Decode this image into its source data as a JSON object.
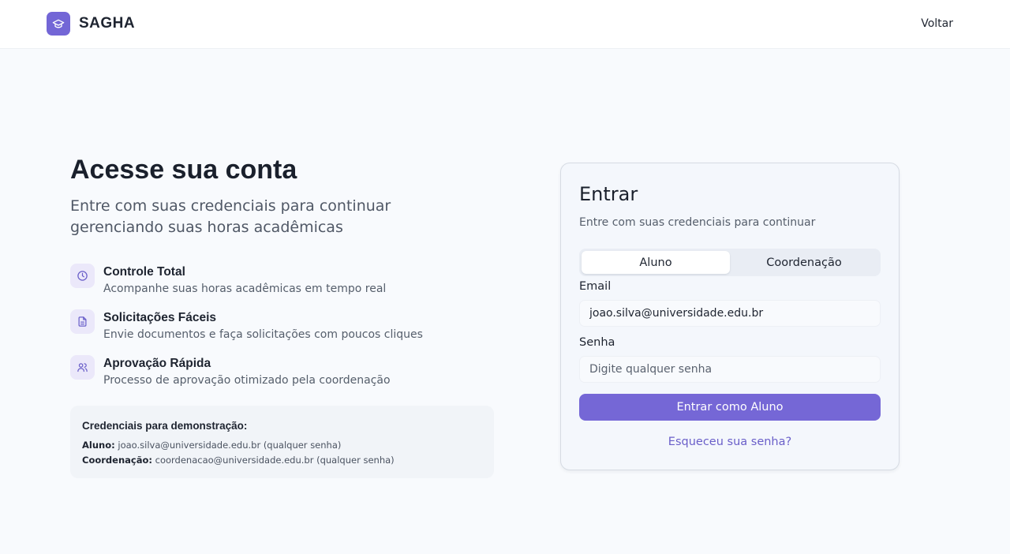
{
  "header": {
    "brand": "SAGHA",
    "back_label": "Voltar",
    "logo_icon": "graduation-cap-icon",
    "accent_color": "#7366d6"
  },
  "hero": {
    "title": "Acesse sua conta",
    "subtitle": "Entre com suas credenciais para continuar gerenciando suas horas acadêmicas"
  },
  "features": [
    {
      "icon": "clock-icon",
      "title": "Controle Total",
      "description": "Acompanhe suas horas acadêmicas em tempo real"
    },
    {
      "icon": "document-icon",
      "title": "Solicitações Fáceis",
      "description": "Envie documentos e faça solicitações com poucos cliques"
    },
    {
      "icon": "users-icon",
      "title": "Aprovação Rápida",
      "description": "Processo de aprovação otimizado pela coordenação"
    }
  ],
  "demo": {
    "title": "Credenciais para demonstração:",
    "student_label": "Aluno:",
    "student_value": "joao.silva@universidade.edu.br (qualquer senha)",
    "coord_label": "Coordenação:",
    "coord_value": "coordenacao@universidade.edu.br (qualquer senha)"
  },
  "login": {
    "title": "Entrar",
    "subtitle": "Entre com suas credenciais para continuar",
    "tabs": [
      "Aluno",
      "Coordenação"
    ],
    "active_tab": "Aluno",
    "email_label": "Email",
    "email_value": "joao.silva@universidade.edu.br",
    "password_label": "Senha",
    "password_placeholder": "Digite qualquer senha",
    "submit_label": "Entrar como Aluno",
    "forgot_label": "Esqueceu sua senha?"
  }
}
